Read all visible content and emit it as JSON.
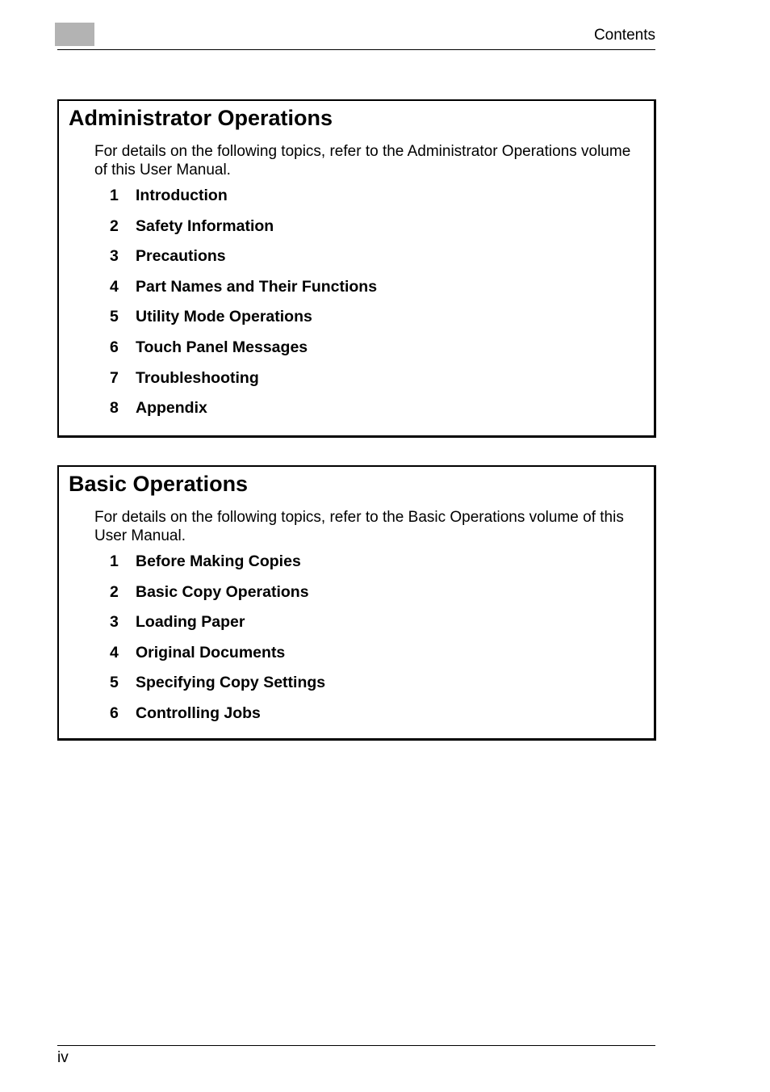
{
  "header": {
    "title": "Contents"
  },
  "sections": [
    {
      "title": "Administrator Operations",
      "intro": "For details on the following topics, refer to the Administrator Operations volume of this User Manual.",
      "items": [
        {
          "num": "1",
          "label": "Introduction"
        },
        {
          "num": "2",
          "label": "Safety Information"
        },
        {
          "num": "3",
          "label": "Precautions"
        },
        {
          "num": "4",
          "label": "Part Names and Their Functions"
        },
        {
          "num": "5",
          "label": "Utility Mode Operations"
        },
        {
          "num": "6",
          "label": "Touch Panel Messages"
        },
        {
          "num": "7",
          "label": "Troubleshooting"
        },
        {
          "num": "8",
          "label": "Appendix"
        }
      ]
    },
    {
      "title": "Basic Operations",
      "intro": "For details on the following topics, refer to the Basic Operations volume of this User Manual.",
      "items": [
        {
          "num": "1",
          "label": "Before Making Copies"
        },
        {
          "num": "2",
          "label": "Basic Copy Operations"
        },
        {
          "num": "3",
          "label": "Loading Paper"
        },
        {
          "num": "4",
          "label": "Original Documents"
        },
        {
          "num": "5",
          "label": "Specifying Copy Settings"
        },
        {
          "num": "6",
          "label": "Controlling Jobs"
        }
      ]
    }
  ],
  "footer": {
    "page_number": "iv"
  }
}
